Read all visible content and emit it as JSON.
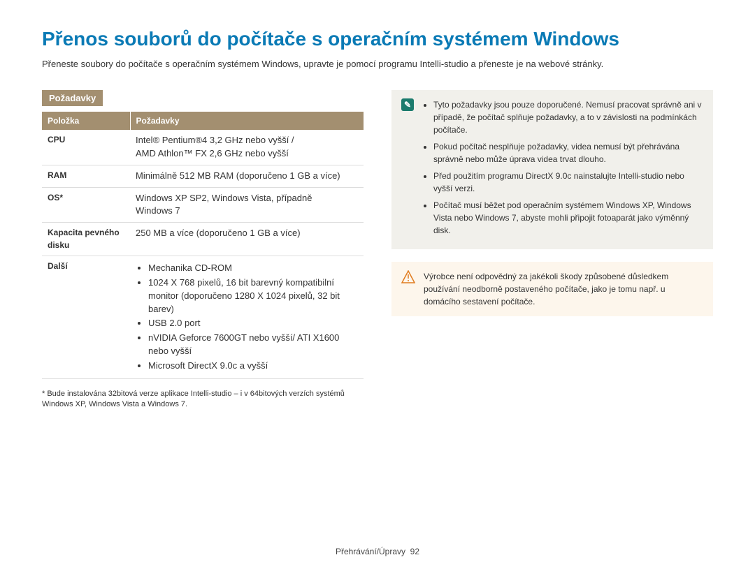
{
  "title": "Přenos souborů do počítače s operačním systémem Windows",
  "intro": "Přeneste soubory do počítače s operačním systémem Windows, upravte je pomocí programu Intelli-studio a přeneste je na webové stránky.",
  "section_title": "Požadavky",
  "table": {
    "head_item": "Položka",
    "head_req": "Požadavky",
    "rows": {
      "cpu_label": "CPU",
      "cpu_value_1": "Intel® Pentium®4 3,2 GHz nebo vyšší /",
      "cpu_value_2": "AMD Athlon™ FX 2,6 GHz nebo vyšší",
      "ram_label": "RAM",
      "ram_value": "Minimálně 512 MB RAM (doporučeno 1 GB a více)",
      "os_label": "OS*",
      "os_value_1": "Windows XP SP2, Windows Vista, případně",
      "os_value_2": "Windows 7",
      "disk_label": "Kapacita pevného disku",
      "disk_value": "250 MB a více (doporučeno 1 GB a více)",
      "other_label": "Další",
      "other_item_1": "Mechanika CD-ROM",
      "other_item_2": "1024 X 768 pixelů, 16 bit barevný kompatibilní monitor (doporučeno 1280 X 1024 pixelů, 32 bit barev)",
      "other_item_3": "USB 2.0 port",
      "other_item_4": "nVIDIA Geforce 7600GT nebo vyšší/ ATI X1600 nebo vyšší",
      "other_item_5": "Microsoft DirectX 9.0c a vyšší"
    }
  },
  "footnote": "* Bude instalována 32bitová verze aplikace Intelli-studio – i v 64bitových verzích systémů Windows XP, Windows Vista a Windows 7.",
  "info_notes": {
    "n1": "Tyto požadavky jsou pouze doporučené. Nemusí pracovat správně ani v případě, že počítač splňuje požadavky, a to v závislosti na podmínkách počítače.",
    "n2": "Pokud počítač nesplňuje požadavky, videa nemusí být přehrávána správně nebo může úprava videa trvat dlouho.",
    "n3": "Před použitím programu DirectX 9.0c nainstalujte Intelli-studio nebo vyšší verzi.",
    "n4": "Počítač musí běžet pod operačním systémem Windows XP, Windows Vista nebo Windows 7, abyste mohli připojit fotoaparát jako výměnný disk."
  },
  "warn_note": "Výrobce není odpovědný za jakékoli škody způsobené důsledkem používání neodborně postaveného počítače, jako je tomu např. u domácího sestavení počítače.",
  "footer": {
    "section": "Přehrávání/Úpravy",
    "page_num": "92"
  },
  "icons": {
    "info_glyph": "✎"
  }
}
